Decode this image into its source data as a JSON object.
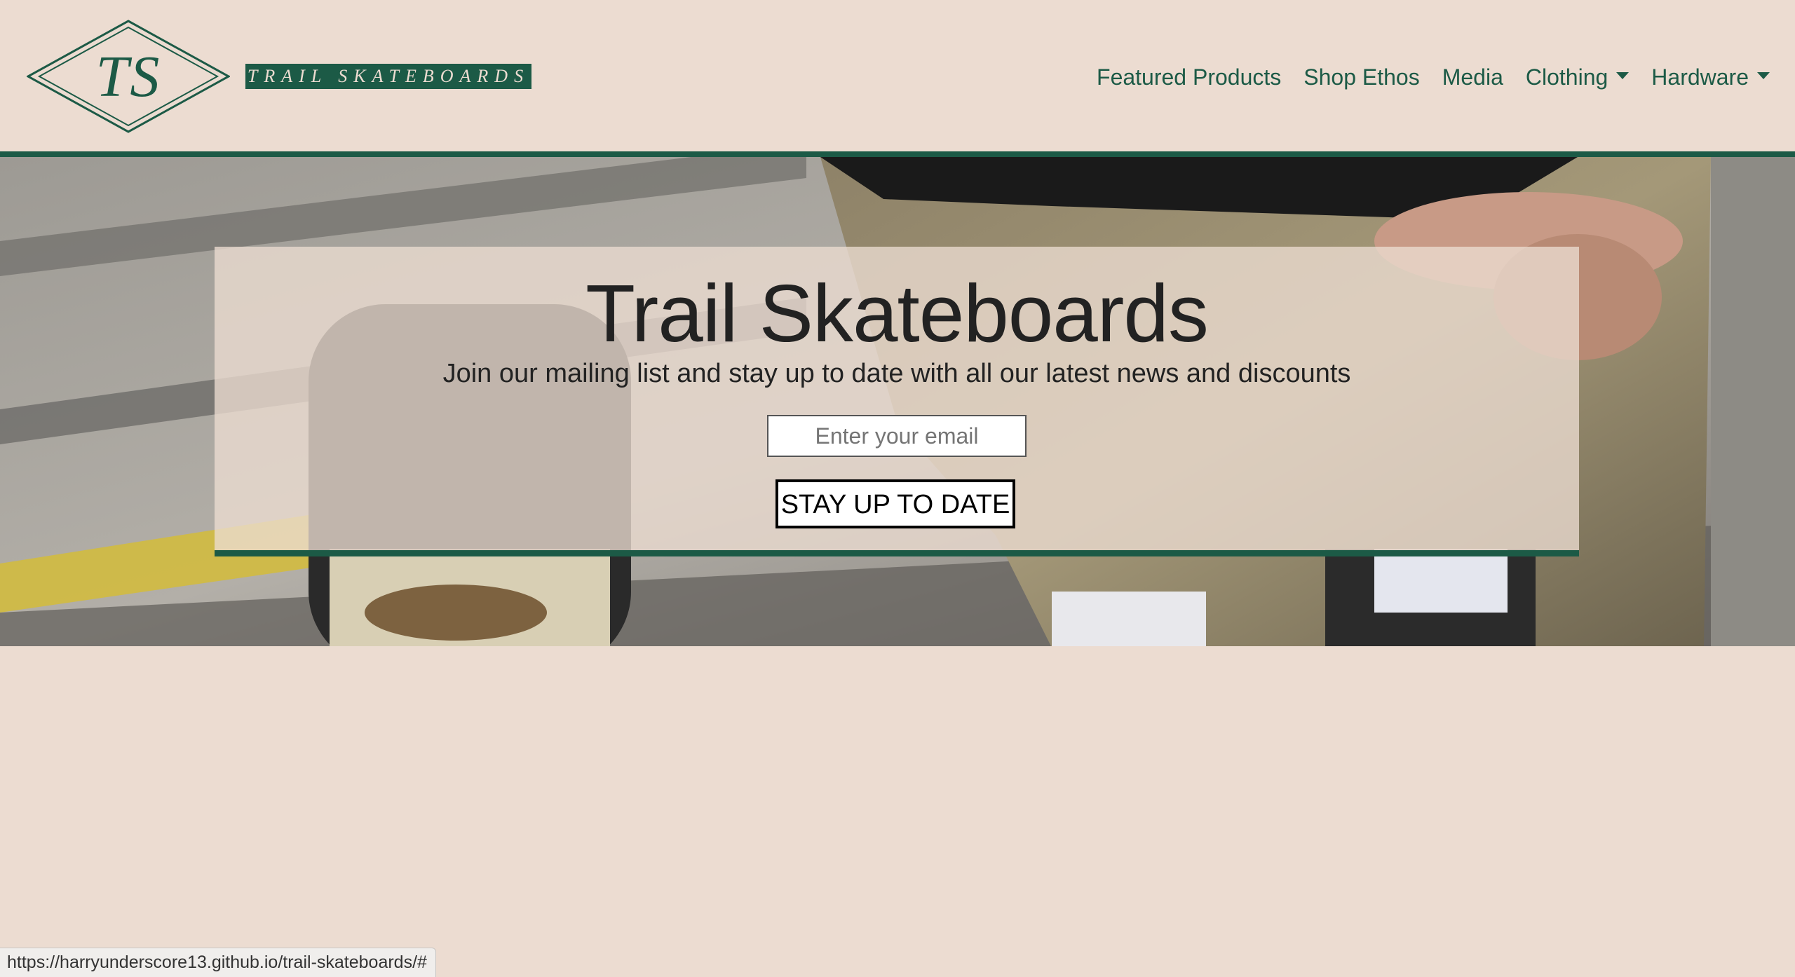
{
  "brand": {
    "monogram": "TS",
    "wordmark": "TRAIL SKATEBOARDS"
  },
  "nav": {
    "items": [
      {
        "label": "Featured Products",
        "dropdown": false
      },
      {
        "label": "Shop Ethos",
        "dropdown": false
      },
      {
        "label": "Media",
        "dropdown": false
      },
      {
        "label": "Clothing",
        "dropdown": true
      },
      {
        "label": "Hardware",
        "dropdown": true
      }
    ]
  },
  "hero": {
    "title": "Trail Skateboards",
    "subtitle": "Join our mailing list and stay up to date with all our latest news and discounts",
    "email_placeholder": "Enter your email",
    "email_value": "",
    "button_label": "STAY UP TO DATE",
    "image_description_icon": "photo-icon"
  },
  "status_bar": {
    "url": "https://harryunderscore13.github.io/trail-skateboards/#"
  },
  "colors": {
    "background": "#ecdcd1",
    "brand_green": "#1c5a46",
    "text_dark": "#222222"
  }
}
